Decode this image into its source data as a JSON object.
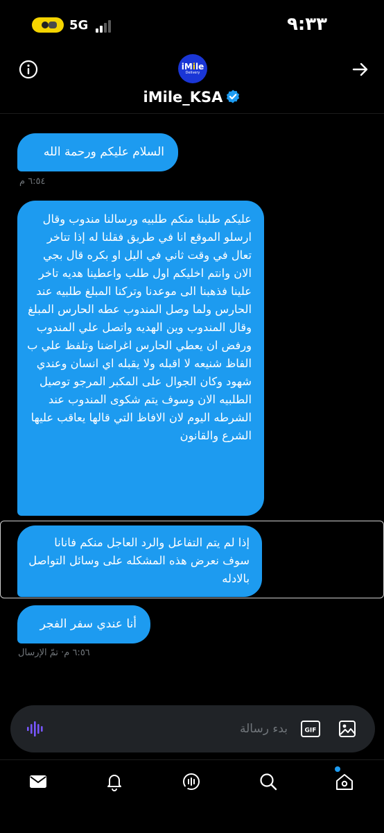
{
  "status_bar": {
    "time": "٩:٣٣",
    "network": "5G"
  },
  "header": {
    "avatar_brand_main_prefix": "iM",
    "avatar_brand_main_accent": "i",
    "avatar_brand_main_suffix": "le",
    "avatar_brand_sub": "Delivery",
    "account_name": "iMile_KSA",
    "verified": true
  },
  "messages": [
    {
      "text": "السلام عليكم ورحمة الله",
      "meta": "٦:٥٤ م"
    },
    {
      "text": "عليكم طلبنا منكم طلبيه ورسالنا مندوب وقال ارسلو الموقع انا في طريق فقلنا له إذا تتاخر تعال في وقت ثاني في الیل او بكره قال بجي الان وانتم اخليكم اول طلب واعطينا هديه تاخر علينا فذهبنا الى موعدنا وتركنا المبلغ طلبيه عند الحارس ولما وصل المندوب عطه الحارس المبلغ وقال المندوب وين الهديه واتصل علي المندوب ورفض ان يعطي الحارس اغراضنا وتلفظ علي ب الفاظ شنيعه لا اقبله ولا يقبله اي انسان وعندي شهود وكان الجوال على المكبر المرجو توصيل الطلبيه الان وسوف يتم شكوى المندوب عند الشرطه اليوم لان الافاظ التي قالها يعاقب عليها الشرع والقانون"
    },
    {
      "text": "إذا لم يتم التفاعل والرد العاجل منكم فانانا سوف نعرض هذه المشكله على وسائل التواصل بالادله",
      "selected": true
    },
    {
      "text": "أنا عندي سفر الفجر",
      "meta": "٦:٥٦ م· تمّ الإرسال"
    }
  ],
  "composer": {
    "placeholder": "بدء رسالة",
    "value": "",
    "gif_label": "GIF"
  },
  "bottom_nav": {
    "items": [
      "messages-icon",
      "notifications-icon",
      "spaces-icon",
      "search-icon",
      "home-icon"
    ],
    "active": "messages-icon"
  },
  "colors": {
    "accent": "#1d9bf0",
    "background": "#000000",
    "muted_text": "#71767b",
    "composer_bg": "#202327",
    "voice_icon": "#7856ff",
    "brand_blue": "#1a36d6",
    "brand_yellow": "#ffd200"
  }
}
